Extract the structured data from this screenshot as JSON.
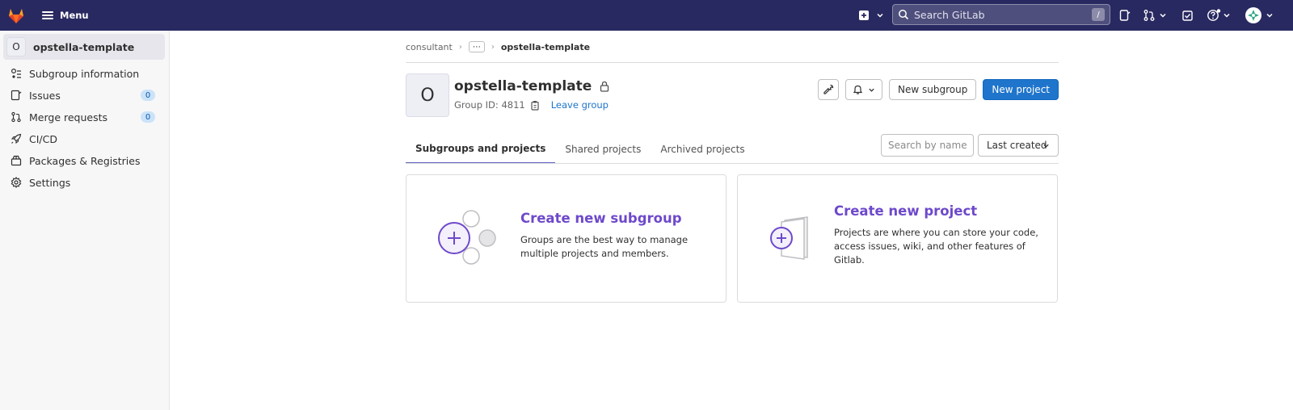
{
  "topbar": {
    "menu_label": "Menu",
    "search_placeholder": "Search GitLab",
    "search_shortcut": "/"
  },
  "sidebar": {
    "context_initial": "O",
    "context_name": "opstella-template",
    "items": [
      {
        "label": "Subgroup information",
        "icon": "group-info-icon"
      },
      {
        "label": "Issues",
        "icon": "issues-icon",
        "badge": "0"
      },
      {
        "label": "Merge requests",
        "icon": "merge-request-icon",
        "badge": "0"
      },
      {
        "label": "CI/CD",
        "icon": "rocket-icon"
      },
      {
        "label": "Packages & Registries",
        "icon": "package-icon"
      },
      {
        "label": "Settings",
        "icon": "gear-icon"
      }
    ]
  },
  "breadcrumb": {
    "root": "consultant",
    "ellipsis": "⋯",
    "current": "opstella-template"
  },
  "group": {
    "initial": "O",
    "name": "opstella-template",
    "id_text": "Group ID: 4811",
    "leave_label": "Leave group"
  },
  "actions": {
    "new_subgroup": "New subgroup",
    "new_project": "New project"
  },
  "tabs": [
    {
      "label": "Subgroups and projects",
      "active": true
    },
    {
      "label": "Shared projects",
      "active": false
    },
    {
      "label": "Archived projects",
      "active": false
    }
  ],
  "filter": {
    "search_placeholder": "Search by name",
    "sort_label": "Last created"
  },
  "cards": {
    "subgroup": {
      "title": "Create new subgroup",
      "desc_line1": "Groups are the best way to manage",
      "desc_line2": "multiple projects and members."
    },
    "project": {
      "title": "Create new project",
      "desc_line1": "Projects are where you can store your code,",
      "desc_line2": "access issues, wiki, and other features of",
      "desc_line3": "Gitlab."
    }
  },
  "colors": {
    "topbar": "#292961",
    "primary": "#1f75cb",
    "accent": "#6e49cb",
    "badge_bg": "#cbe2f9"
  }
}
